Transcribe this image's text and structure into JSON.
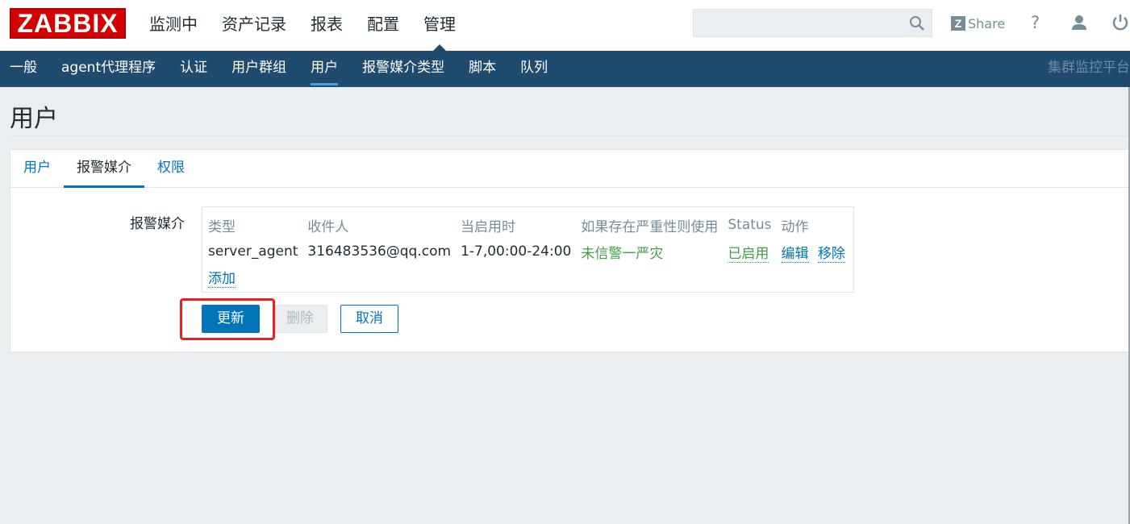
{
  "header": {
    "logo": "ZABBIX",
    "nav": [
      {
        "label": "监测中"
      },
      {
        "label": "资产记录"
      },
      {
        "label": "报表"
      },
      {
        "label": "配置"
      },
      {
        "label": "管理",
        "active": true
      }
    ],
    "search": {
      "value": "",
      "placeholder": ""
    },
    "share_label": "Share",
    "help_label": "?",
    "icons": [
      "search-icon",
      "zabbix-share-icon",
      "help-icon",
      "user-icon",
      "power-icon"
    ]
  },
  "subnav": {
    "items": [
      {
        "label": "一般"
      },
      {
        "label": "agent代理程序"
      },
      {
        "label": "认证"
      },
      {
        "label": "用户群组"
      },
      {
        "label": "用户",
        "active": true
      },
      {
        "label": "报警媒介类型"
      },
      {
        "label": "脚本"
      },
      {
        "label": "队列"
      }
    ],
    "server_name": "集群监控平台"
  },
  "page": {
    "title": "用户"
  },
  "tabs": [
    {
      "label": "用户"
    },
    {
      "label": "报警媒介",
      "active": true
    },
    {
      "label": "权限"
    }
  ],
  "media": {
    "label": "报警媒介",
    "columns": {
      "type": "类型",
      "send_to": "收件人",
      "when_active": "当启用时",
      "severity": "如果存在严重性则使用",
      "status": "Status",
      "action": "动作"
    },
    "rows": [
      {
        "type": "server_agent",
        "send_to": "316483536@qq.com",
        "when_active": "1-7,00:00-24:00",
        "severity": "未信警一严灾",
        "status": "已启用",
        "edit": "编辑",
        "remove": "移除"
      }
    ],
    "add_label": "添加"
  },
  "buttons": {
    "update": "更新",
    "delete": "删除",
    "cancel": "取消"
  },
  "colors": {
    "brand": "#d40000",
    "subnav_bg": "#1f4b6e",
    "link": "#0275b8",
    "status_green": "#429e47",
    "highlight_red": "#e8201f"
  }
}
